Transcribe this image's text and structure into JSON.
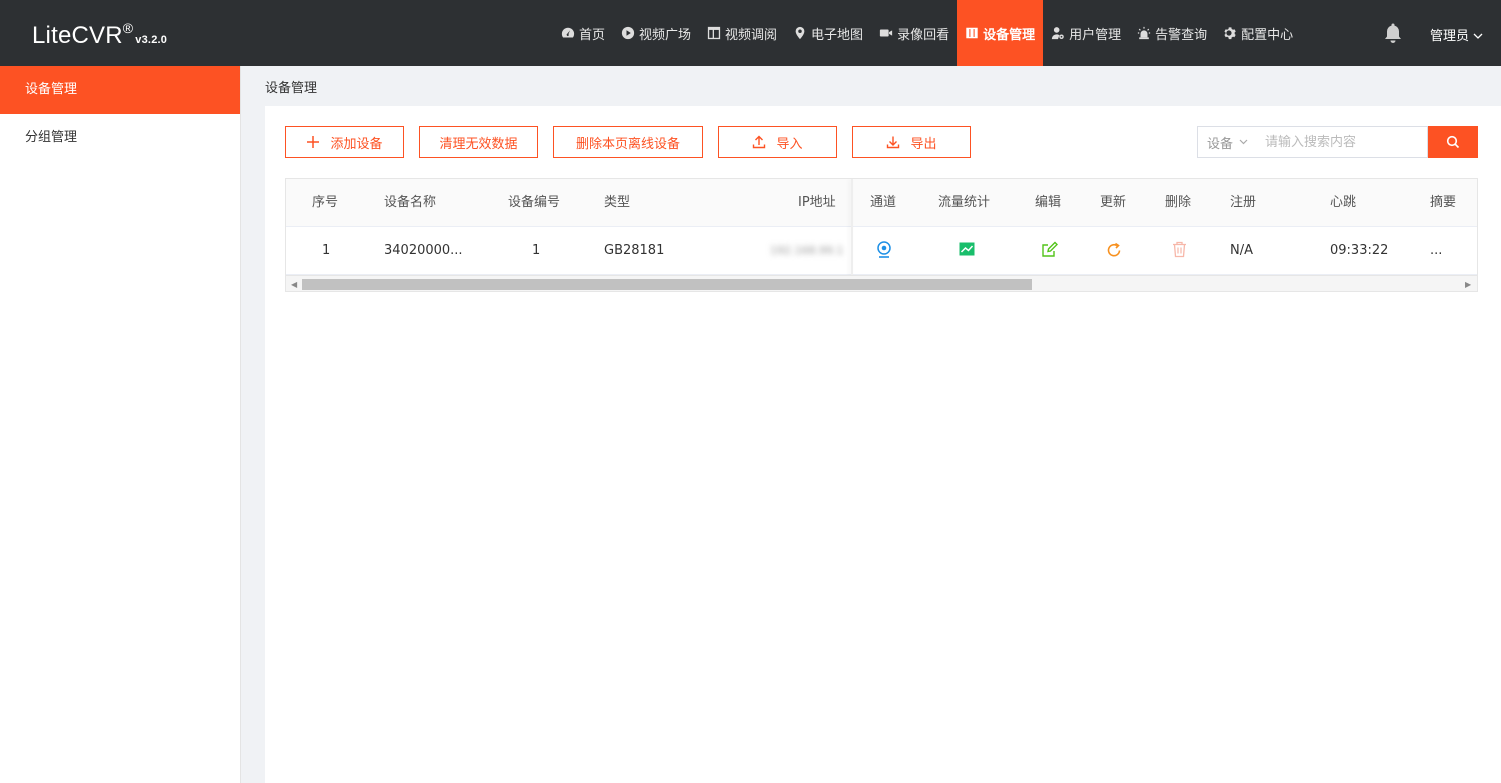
{
  "app": {
    "name": "LiteCVR",
    "reg": "®",
    "version": "v3.2.0"
  },
  "nav": [
    {
      "label": "首页",
      "icon": "dashboard-icon",
      "active": false
    },
    {
      "label": "视频广场",
      "icon": "play-circle-icon",
      "active": false
    },
    {
      "label": "视频调阅",
      "icon": "layout-icon",
      "active": false
    },
    {
      "label": "电子地图",
      "icon": "map-pin-icon",
      "active": false
    },
    {
      "label": "录像回看",
      "icon": "video-camera-icon",
      "active": false
    },
    {
      "label": "设备管理",
      "icon": "columns-icon",
      "active": true
    },
    {
      "label": "用户管理",
      "icon": "user-gear-icon",
      "active": false
    },
    {
      "label": "告警查询",
      "icon": "alarm-light-icon",
      "active": false
    },
    {
      "label": "配置中心",
      "icon": "gear-icon",
      "active": false
    }
  ],
  "user": {
    "label": "管理员"
  },
  "sidebar": {
    "items": [
      {
        "label": "设备管理",
        "active": true
      },
      {
        "label": "分组管理",
        "active": false
      }
    ]
  },
  "breadcrumb": "设备管理",
  "toolbar": {
    "add_label": "添加设备",
    "clear_label": "清理无效数据",
    "delete_offline_label": "删除本页离线设备",
    "import_label": "导入",
    "export_label": "导出"
  },
  "search": {
    "scope": "设备",
    "placeholder": "请输入搜索内容"
  },
  "table": {
    "headers": {
      "index": "序号",
      "name": "设备名称",
      "code": "设备编号",
      "type": "类型",
      "ip": "IP地址",
      "channel": "通道",
      "traffic": "流量统计",
      "edit": "编辑",
      "update": "更新",
      "delete": "删除",
      "register": "注册",
      "heartbeat": "心跳",
      "summary": "摘要"
    },
    "rows": [
      {
        "index": "1",
        "name": "34020000...",
        "code": "1",
        "type": "GB28181",
        "ip": "192.168.99.1",
        "register": "N/A",
        "heartbeat": "09:33:22",
        "summary": "..."
      }
    ]
  },
  "colors": {
    "accent": "#fd5223",
    "topbar": "#2d3033",
    "channel_icon": "#1e90e6",
    "traffic_icon": "#19be6b",
    "edit_icon": "#52c41a",
    "update_icon": "#f7901e",
    "delete_icon": "#f7b7a9"
  }
}
